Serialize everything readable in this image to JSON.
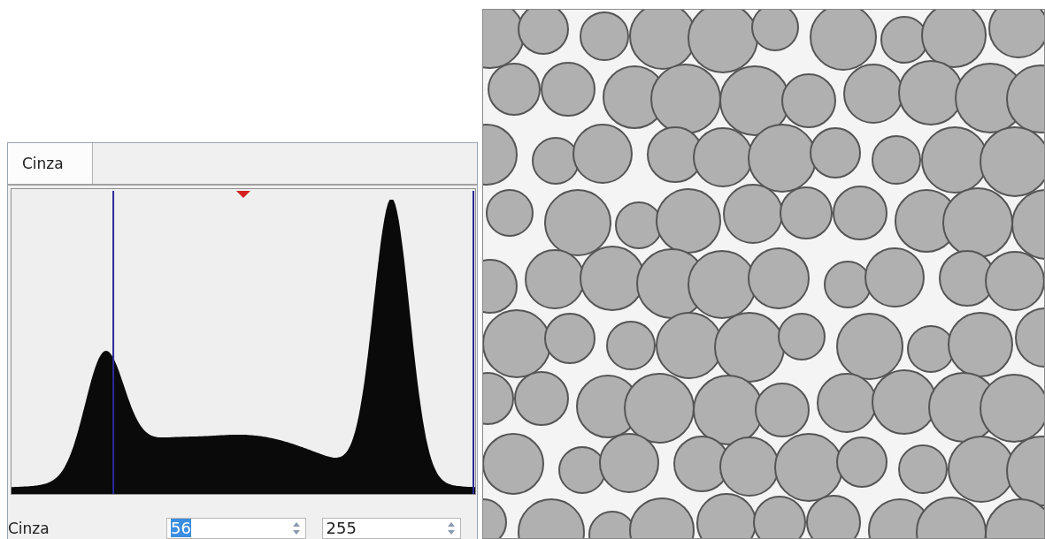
{
  "histogram_panel": {
    "tabs": [
      {
        "label": "Cinza",
        "selected": true
      }
    ],
    "footer": {
      "label": "Cinza",
      "min_value": "56",
      "max_value": "255"
    }
  }
}
